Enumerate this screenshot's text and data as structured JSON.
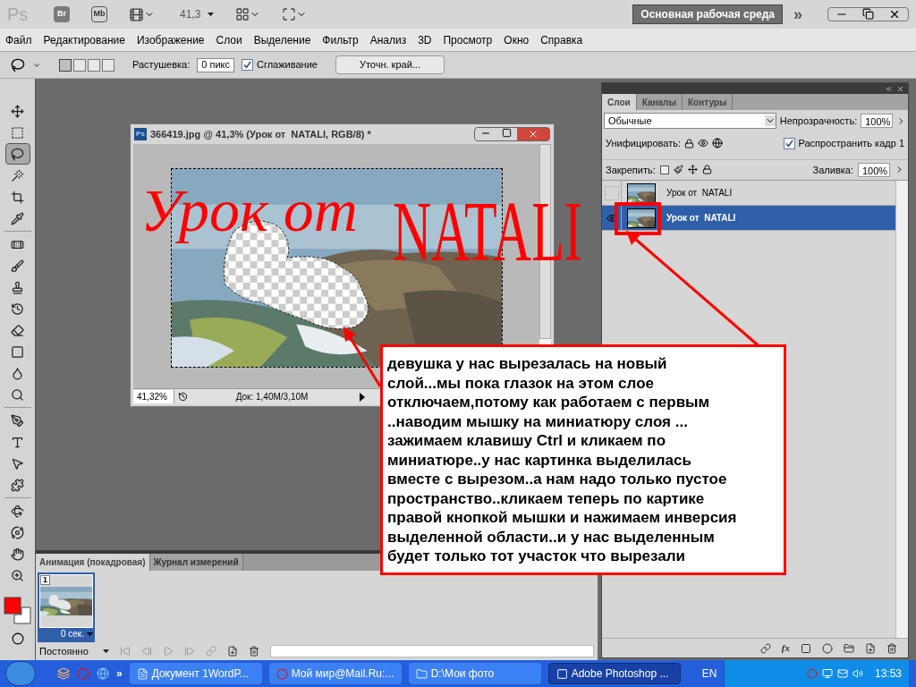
{
  "app_bar": {
    "logo": "Ps",
    "bridge": "Br",
    "mini_bridge": "Mb",
    "zoom": "41,3",
    "workspace": "Основная рабочая среда",
    "more": "»"
  },
  "menu": [
    "Файл",
    "Редактирование",
    "Изображение",
    "Слои",
    "Выделение",
    "Фильтр",
    "Анализ",
    "3D",
    "Просмотр",
    "Окно",
    "Справка"
  ],
  "options": {
    "modes": [
      {
        "selected": true
      },
      {
        "selected": false
      },
      {
        "selected": false
      },
      {
        "selected": false
      }
    ],
    "feather_label": "Растушевка:",
    "feather_value": "0 пикс",
    "antialias": {
      "label": "Сглаживание",
      "checked": true
    },
    "refine_button": "Уточн. край..."
  },
  "tools": [
    {
      "selected": false
    },
    {
      "selected": false
    },
    {
      "selected": true
    },
    {
      "selected": false
    },
    {
      "selected": false
    },
    {
      "selected": false
    },
    {
      "selected": false
    },
    {
      "selected": false
    },
    {
      "selected": false
    },
    {
      "selected": false
    },
    {
      "selected": false
    },
    {
      "selected": false
    },
    {
      "selected": false
    },
    {
      "selected": false
    },
    {
      "selected": false
    },
    {
      "selected": false
    },
    {
      "selected": false
    },
    {
      "selected": false
    },
    {
      "selected": false
    },
    {
      "selected": false
    },
    {
      "selected": false
    },
    {
      "selected": false
    }
  ],
  "swatches": [
    {
      "color": "#ff0000"
    },
    {
      "color": "#ffffff"
    }
  ],
  "document": {
    "icon_label": "Ps",
    "title": "366419.jpg @ 41,3% (Урок от  NATALI, RGB/8) *",
    "canvas_text": [
      {
        "kind": "script",
        "text": "Урок от"
      },
      {
        "kind": "caps",
        "text": "NATALI"
      }
    ],
    "zoom": "41,32%",
    "doc_info": "Док: 1,40M/3,10M"
  },
  "animation": {
    "tabs": [
      {
        "label": "Анимация (покадровая)",
        "selected": true
      },
      {
        "label": "Журнал измерений",
        "selected": false
      }
    ],
    "frames": [
      {
        "number": "1",
        "delay": "0 сек.",
        "selected": true
      }
    ],
    "loop": "Постоянно"
  },
  "layers_panel": {
    "tabs": [
      {
        "label": "Слои",
        "selected": true
      },
      {
        "label": "Каналы",
        "selected": false
      },
      {
        "label": "Контуры",
        "selected": false
      }
    ],
    "blend_mode": "Обычные",
    "opacity_label": "Непрозрачность:",
    "opacity": "100%",
    "unify_label": "Унифицировать:",
    "propagate": {
      "label": "Распространить кадр 1",
      "checked": true
    },
    "lock_label": "Закрепить:",
    "fill_label": "Заливка:",
    "fill": "100%",
    "effects_label": "fx",
    "layers": [
      {
        "name": "Урок от  NATALI",
        "visible": false,
        "selected": false
      },
      {
        "name": "Урок от  NATALI",
        "visible": true,
        "selected": true
      }
    ]
  },
  "callout": {
    "lines": [
      "девушка у нас вырезалась на новый",
      "слой...мы пока глазок на этом слое",
      "отключаем,потому как работаем с первым",
      "..наводим мышку на миниатюру слоя ...",
      "зажимаем клавишу Ctrl и кликаем по",
      "миниатюре..у нас картинка  выделилась",
      "вместе с вырезом..а нам надо только пустое",
      "пространство..кликаем теперь по картике",
      "правой кнопкой мышки и нажимаем инверсия",
      "выделенной области..и у нас выделенным",
      "будет только тот участок что вырезали"
    ]
  },
  "taskbar": {
    "more": "»",
    "tasks": [
      {
        "label": "Документ 1WordP...",
        "kind": "document",
        "selected": false
      },
      {
        "label": "Мой мир@Mail.Ru:...",
        "kind": "browser",
        "selected": false
      },
      {
        "label": "D:\\Мои фото",
        "kind": "folder",
        "selected": false
      },
      {
        "label": "Adobe Photoshop ...",
        "kind": "photoshop",
        "selected": true
      }
    ],
    "language": "EN",
    "clock": "13:53"
  }
}
